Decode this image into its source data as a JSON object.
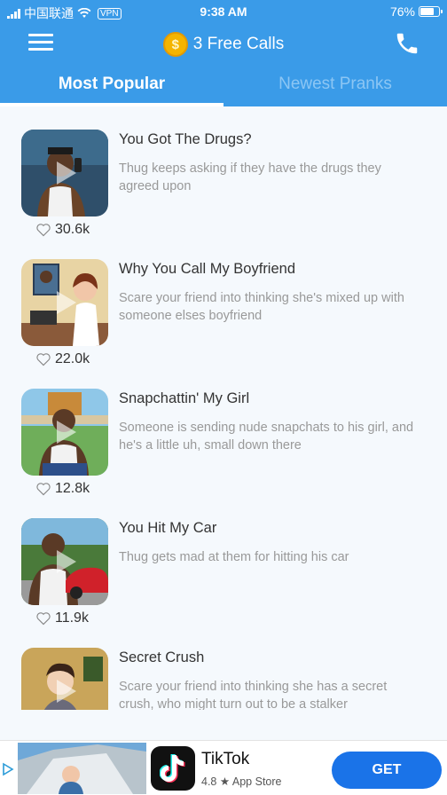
{
  "status_bar": {
    "carrier": "中国联通",
    "vpn": "VPN",
    "time": "9:38 AM",
    "battery": "76%",
    "battery_level": 0.76
  },
  "header": {
    "free_calls": "3 Free Calls",
    "coin_symbol": "$",
    "tabs": [
      {
        "label": "Most Popular",
        "active": true
      },
      {
        "label": "Newest Pranks",
        "active": false
      }
    ],
    "colors": {
      "background": "#3a9be8",
      "active_tab": "#ffffff",
      "inactive_tab": "#8cc6f4"
    }
  },
  "pranks": [
    {
      "title": "You Got The Drugs?",
      "description": "Thug keeps asking if they have the drugs they agreed upon",
      "likes": "30.6k"
    },
    {
      "title": "Why You Call My Boyfriend",
      "description": "Scare your friend into thinking she's mixed up with someone elses boyfriend",
      "likes": "22.0k"
    },
    {
      "title": "Snapchattin' My Girl",
      "description": "Someone is sending nude snapchats to his girl, and he's a little uh, small down there",
      "likes": "12.8k"
    },
    {
      "title": "You Hit My Car",
      "description": "Thug gets mad at them for hitting his car",
      "likes": "11.9k"
    },
    {
      "title": "Secret Crush",
      "description": "Scare your friend into thinking she has a secret crush, who might turn out to be a stalker",
      "likes": ""
    }
  ],
  "ad": {
    "app_name": "TikTok",
    "rating": "4.8",
    "star": "★",
    "store": "App Store",
    "button_label": "GET",
    "button_color": "#1a73e8"
  }
}
